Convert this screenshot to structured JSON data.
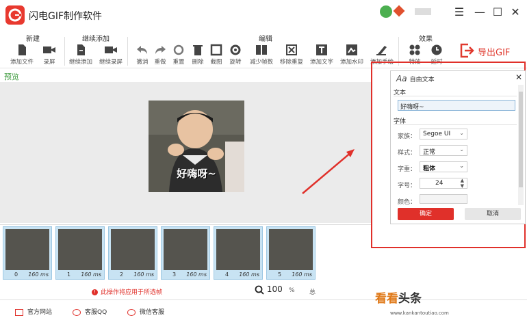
{
  "app": {
    "title": "闪电GIF制作软件"
  },
  "toolbar": {
    "groups": {
      "new": "新建",
      "continue_add": "继续添加",
      "edit": "编辑",
      "effects": "效果"
    },
    "tools": [
      {
        "label": "添加文件",
        "icon": "file-icon"
      },
      {
        "label": "录屏",
        "icon": "camera-icon"
      },
      {
        "label": "继续添加",
        "icon": "file-add-icon"
      },
      {
        "label": "继续录屏",
        "icon": "camera-add-icon"
      },
      {
        "label": "撤消",
        "icon": "undo-icon"
      },
      {
        "label": "重做",
        "icon": "redo-icon"
      },
      {
        "label": "重置",
        "icon": "reset-icon"
      },
      {
        "label": "删除",
        "icon": "trash-icon"
      },
      {
        "label": "截图",
        "icon": "crop-icon"
      },
      {
        "label": "旋转",
        "icon": "rotate-icon"
      },
      {
        "label": "减少帧数",
        "icon": "reduce-frames-icon"
      },
      {
        "label": "移除重复",
        "icon": "remove-duplicates-icon"
      },
      {
        "label": "添加文字",
        "icon": "text-icon"
      },
      {
        "label": "添加水印",
        "icon": "watermark-icon"
      },
      {
        "label": "添加手绘",
        "icon": "brush-icon"
      },
      {
        "label": "特效",
        "icon": "effects-icon"
      },
      {
        "label": "延时",
        "icon": "clock-icon"
      }
    ],
    "export_label": "导出GIF"
  },
  "preview": {
    "label": "预览",
    "caption": "好嗨呀~"
  },
  "text_panel": {
    "title": "自由文本",
    "section_text": "文本",
    "text_value": "好嗨呀~",
    "section_font": "字体",
    "family_label": "家族：",
    "family_value": "Segoe UI",
    "style_label": "样式：",
    "style_value": "正常",
    "weight_label": "字重：",
    "weight_value": "粗体",
    "size_label": "字号：",
    "size_value": "24",
    "color_label": "颜色：",
    "ok_label": "确定",
    "cancel_label": "取消"
  },
  "frames": [
    {
      "index": "0",
      "duration": "160 ms"
    },
    {
      "index": "1",
      "duration": "160 ms"
    },
    {
      "index": "2",
      "duration": "160 ms"
    },
    {
      "index": "3",
      "duration": "160 ms"
    },
    {
      "index": "4",
      "duration": "160 ms"
    },
    {
      "index": "5",
      "duration": "160 ms"
    }
  ],
  "status": {
    "warning": "此操作将应用于所选帧",
    "zoom_value": "100",
    "zoom_unit": "%",
    "total_label": "总"
  },
  "footer": {
    "website": "官方网站",
    "qq": "客服QQ",
    "wechat": "微信客服"
  },
  "watermark": {
    "text_a": "看看",
    "text_b": "头条",
    "url": "www.kankantoutiao.com"
  },
  "colors": {
    "accent": "#e0302a",
    "preview_bg": "#ebebeb",
    "frame_bg": "#c8e3f3",
    "preview_label": "#3b9a3b"
  }
}
